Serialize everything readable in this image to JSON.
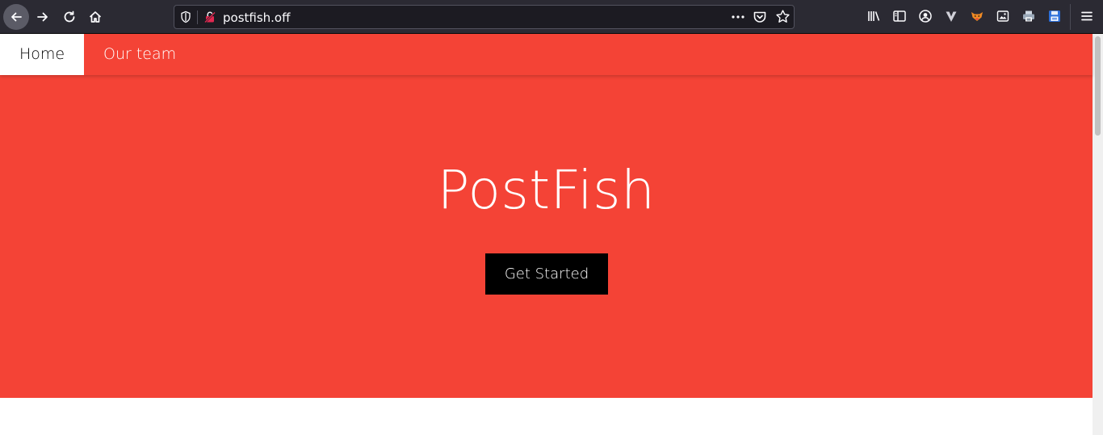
{
  "browser": {
    "url": "postfish.off",
    "nav_icons": [
      "arrow-back-icon",
      "arrow-forward-icon",
      "reload-icon",
      "home-icon"
    ],
    "toolbar_icons": [
      "library-icon",
      "sidebar-icon",
      "account-icon",
      "vivaldi-icon",
      "extension-fox-icon",
      "extension-screenshot-icon",
      "extension-printer-icon",
      "extension-save-icon",
      "menu-icon"
    ]
  },
  "site": {
    "nav": {
      "home": "Home",
      "team": "Our team"
    },
    "hero": {
      "title": "PostFish",
      "cta": "Get Started"
    },
    "colors": {
      "brand_red": "#f44336",
      "button_black": "#000000"
    }
  }
}
